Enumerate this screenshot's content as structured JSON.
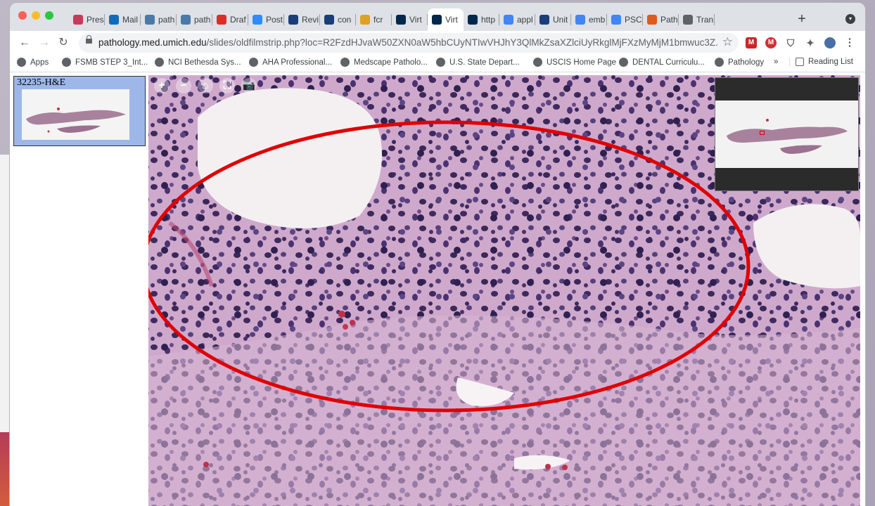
{
  "browser": {
    "tabs": [
      {
        "label": "Pres",
        "icon": "presentation-icon",
        "color": "#c83a5a"
      },
      {
        "label": "Mail",
        "icon": "outlook-mail-icon",
        "color": "#0f6cbd"
      },
      {
        "label": "path",
        "icon": "pathology-icon",
        "color": "#4a7ba8"
      },
      {
        "label": "path",
        "icon": "pathology-icon",
        "color": "#4a7ba8"
      },
      {
        "label": "Draf",
        "icon": "gmail-icon",
        "color": "#d93025"
      },
      {
        "label": "Post",
        "icon": "zoom-icon",
        "color": "#2d8cff"
      },
      {
        "label": "Revi",
        "icon": "journal-icon",
        "color": "#1a3e7a"
      },
      {
        "label": "con",
        "icon": "journal-icon",
        "color": "#1a3e7a"
      },
      {
        "label": "fcr",
        "icon": "bookmark-icon",
        "color": "#e0a020"
      },
      {
        "label": "Virt",
        "icon": "umich-icon",
        "color": "#00274c"
      },
      {
        "label": "Virt",
        "icon": "umich-icon",
        "color": "#00274c",
        "active": true
      },
      {
        "label": "http",
        "icon": "umich-icon",
        "color": "#00274c"
      },
      {
        "label": "appl",
        "icon": "google-icon",
        "color": "#4285f4"
      },
      {
        "label": "Unit",
        "icon": "journal-icon",
        "color": "#1a3e7a"
      },
      {
        "label": "emb",
        "icon": "google-icon",
        "color": "#4285f4"
      },
      {
        "label": "PSC",
        "icon": "google-icon",
        "color": "#4285f4"
      },
      {
        "label": "Path",
        "icon": "pathology-outlines-icon",
        "color": "#e05a1a"
      },
      {
        "label": "Tran",
        "icon": "globe-icon",
        "color": "#5f6368"
      }
    ],
    "url_domain": "pathology.med.umich.edu",
    "url_path": "/slides/oldfilmstrip.php?loc=R2FzdHJvaW50ZXN0aW5hbCUyNTIwVHJhY3QlMkZsaXZlciUyRkglMjFXzMyMjM1bmwuc3Z...",
    "bookmarks": [
      {
        "label": "Apps",
        "icon": "apps-grid-icon"
      },
      {
        "label": "FSMB STEP 3_Int...",
        "icon": "globe-icon"
      },
      {
        "label": "NCI Bethesda Sys...",
        "icon": "globe-icon"
      },
      {
        "label": "AHA Professional...",
        "icon": "aha-icon"
      },
      {
        "label": "Medscape Patholo...",
        "icon": "medscape-icon"
      },
      {
        "label": "U.S. State Depart...",
        "icon": "globe-icon"
      },
      {
        "label": "USCIS Home Page",
        "icon": "uscis-seal-icon"
      },
      {
        "label": "DENTAL Curriculu...",
        "icon": "uf-icon"
      },
      {
        "label": "Pathology",
        "icon": "person-icon"
      }
    ],
    "bookmarks_more": "»",
    "reading_list": "Reading List"
  },
  "viewer": {
    "slide_label": "32235-H&E",
    "controls": [
      "+",
      "−",
      "⌂",
      "⛶",
      "📷"
    ]
  }
}
